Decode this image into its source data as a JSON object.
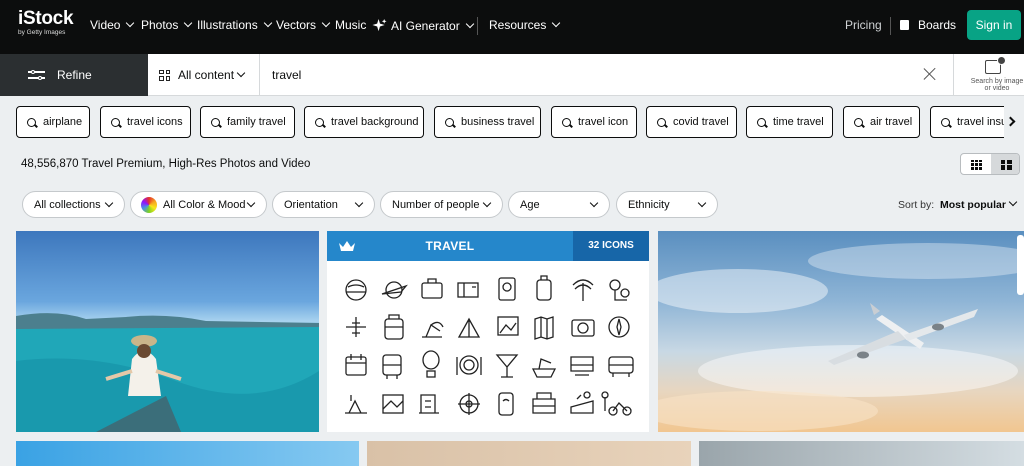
{
  "brand": {
    "name": "iStock",
    "tagline": "by Getty Images"
  },
  "nav": {
    "items": [
      {
        "label": "Video",
        "dropdown": true
      },
      {
        "label": "Photos",
        "dropdown": true
      },
      {
        "label": "Illustrations",
        "dropdown": true
      },
      {
        "label": "Vectors",
        "dropdown": true
      },
      {
        "label": "Music",
        "dropdown": false
      },
      {
        "label": "AI Generator",
        "dropdown": true
      },
      {
        "label": "Resources",
        "dropdown": true
      }
    ],
    "pricing": "Pricing",
    "boards": "Boards",
    "signin": "Sign in"
  },
  "search": {
    "refine": "Refine",
    "scope": "All content",
    "query": "travel",
    "image_search": "Search by image or video"
  },
  "suggestions": [
    "airplane",
    "travel icons",
    "family travel",
    "travel background",
    "business travel",
    "travel icon",
    "covid travel",
    "time travel",
    "air travel",
    "travel insurance"
  ],
  "results": {
    "count_text": "48,556,870 Travel Premium, High-Res Photos and Video"
  },
  "filters": [
    "All collections",
    "All Color & Mood",
    "Orientation",
    "Number of people",
    "Age",
    "Ethnicity"
  ],
  "sort": {
    "label": "Sort by:",
    "value": "Most popular"
  },
  "iconset": {
    "title": "TRAVEL",
    "count": "32 ICONS"
  },
  "colors": {
    "accent": "#08a385",
    "nav_bg": "#0c0d0d",
    "iconset_blue": "#2587cb"
  }
}
